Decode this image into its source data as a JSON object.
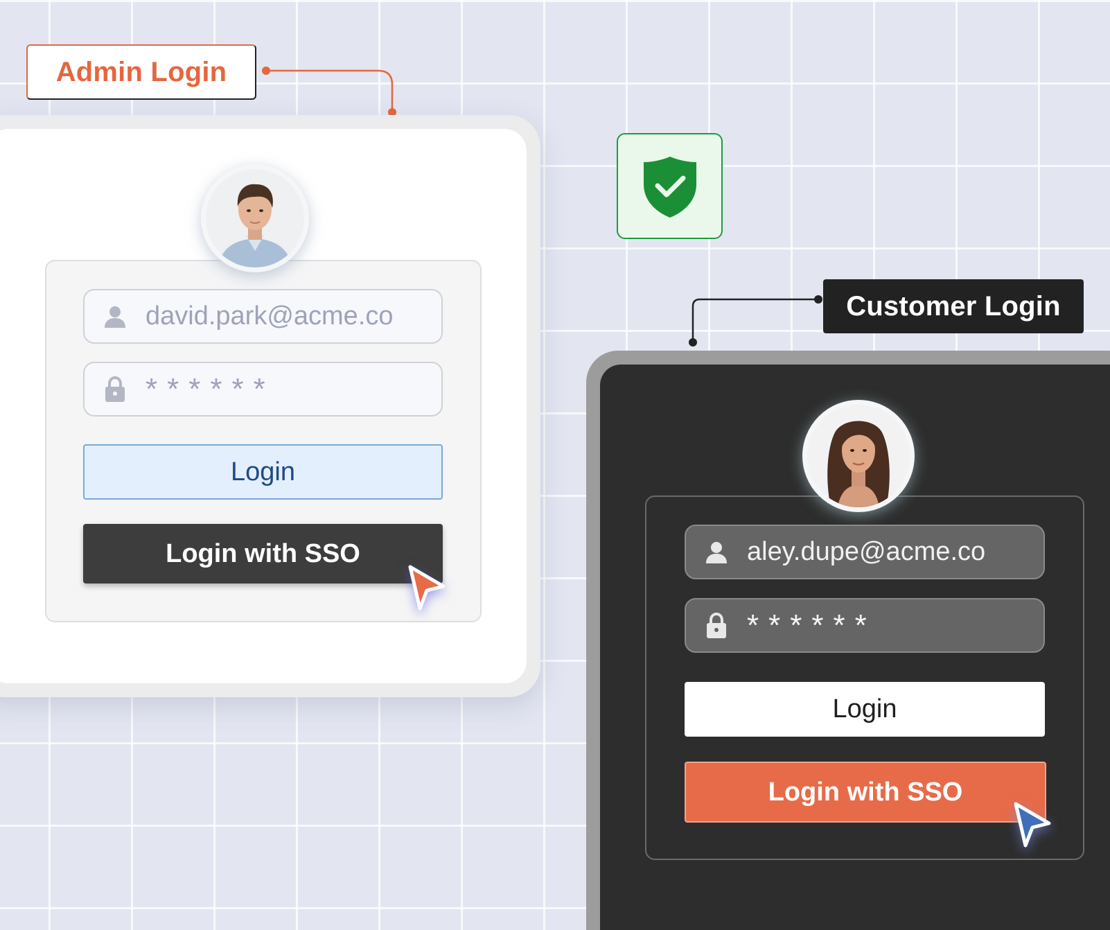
{
  "admin": {
    "tag": "Admin Login",
    "email": "david.park@acme.co",
    "password": "******",
    "login_label": "Login",
    "sso_label": "Login with SSO"
  },
  "customer": {
    "tag": "Customer Login",
    "email": "aley.dupe@acme.co",
    "password": "******",
    "login_label": "Login",
    "sso_label": "Login with SSO"
  },
  "colors": {
    "accent_orange": "#e76b48",
    "secure_green": "#1e9b3c",
    "cursor_blue": "#3e6fb8"
  },
  "icons": [
    "user-icon",
    "lock-icon",
    "shield-check-icon",
    "cursor-pointer-icon"
  ]
}
